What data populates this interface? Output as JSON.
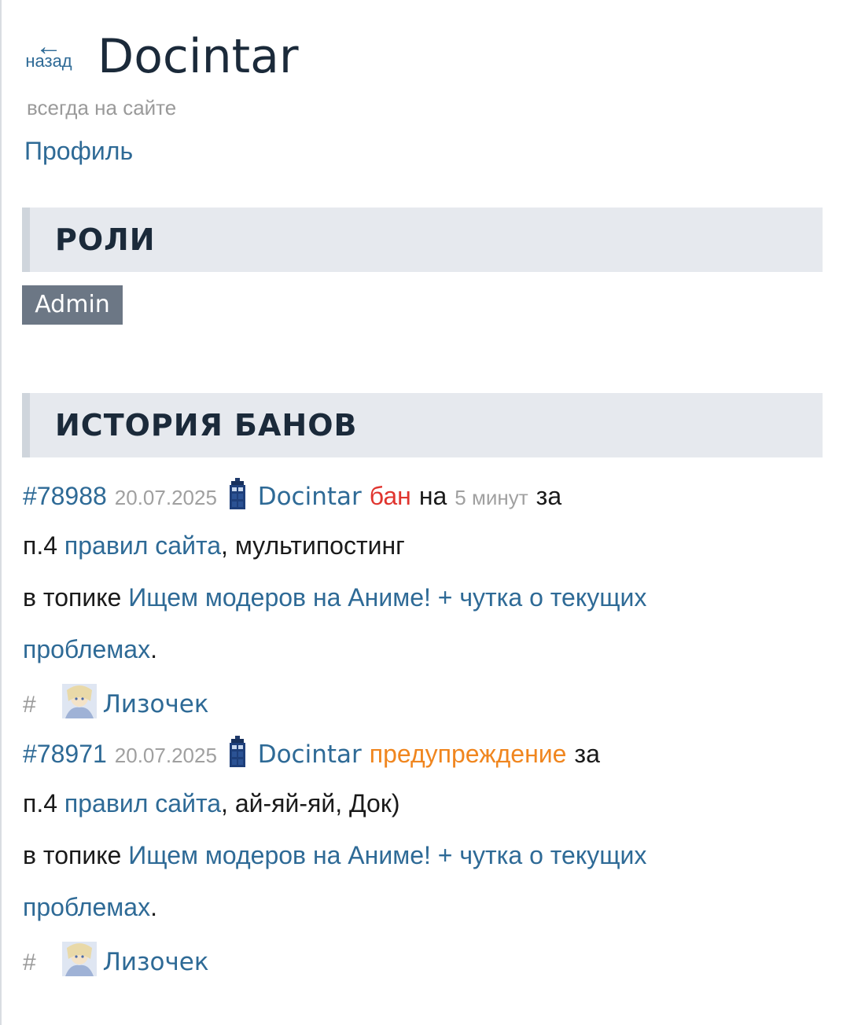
{
  "header": {
    "back_label": "назад",
    "back_arrow": "←",
    "username": "Docintar",
    "status": "всегда на сайте",
    "profile_link": "Профиль"
  },
  "roles": {
    "heading": "РОЛИ",
    "items": [
      "Admin"
    ]
  },
  "bans": {
    "heading": "ИСТОРИЯ БАНОВ",
    "entries": [
      {
        "id": "#78988",
        "date": "20.07.2025",
        "icon": "tardis-icon",
        "user": "Docintar",
        "action": "бан",
        "action_color": "#e0352f",
        "on_word": "на",
        "duration": "5 минут",
        "for_word": "за",
        "rule_prefix": "п.4",
        "rule_link": "правил сайта",
        "reason": ", мультипостинг",
        "topic_prefix": "в топике",
        "topic_link_1": "Ищем модеров на Аниме! + чутка о текущих",
        "topic_link_2": "проблемах",
        "topic_end": ".",
        "hash": "#",
        "moderator": "Лизочек"
      },
      {
        "id": "#78971",
        "date": "20.07.2025",
        "icon": "tardis-icon",
        "user": "Docintar",
        "action": "предупреждение",
        "action_color": "#f0861f",
        "for_word": "за",
        "rule_prefix": "п.4",
        "rule_link": "правил сайта",
        "reason": ", ай-яй-яй, Док)",
        "topic_prefix": "в топике",
        "topic_link_1": "Ищем модеров на Аниме! + чутка о текущих",
        "topic_link_2": "проблемах",
        "topic_end": ".",
        "hash": "#",
        "moderator": "Лизочек"
      }
    ]
  }
}
